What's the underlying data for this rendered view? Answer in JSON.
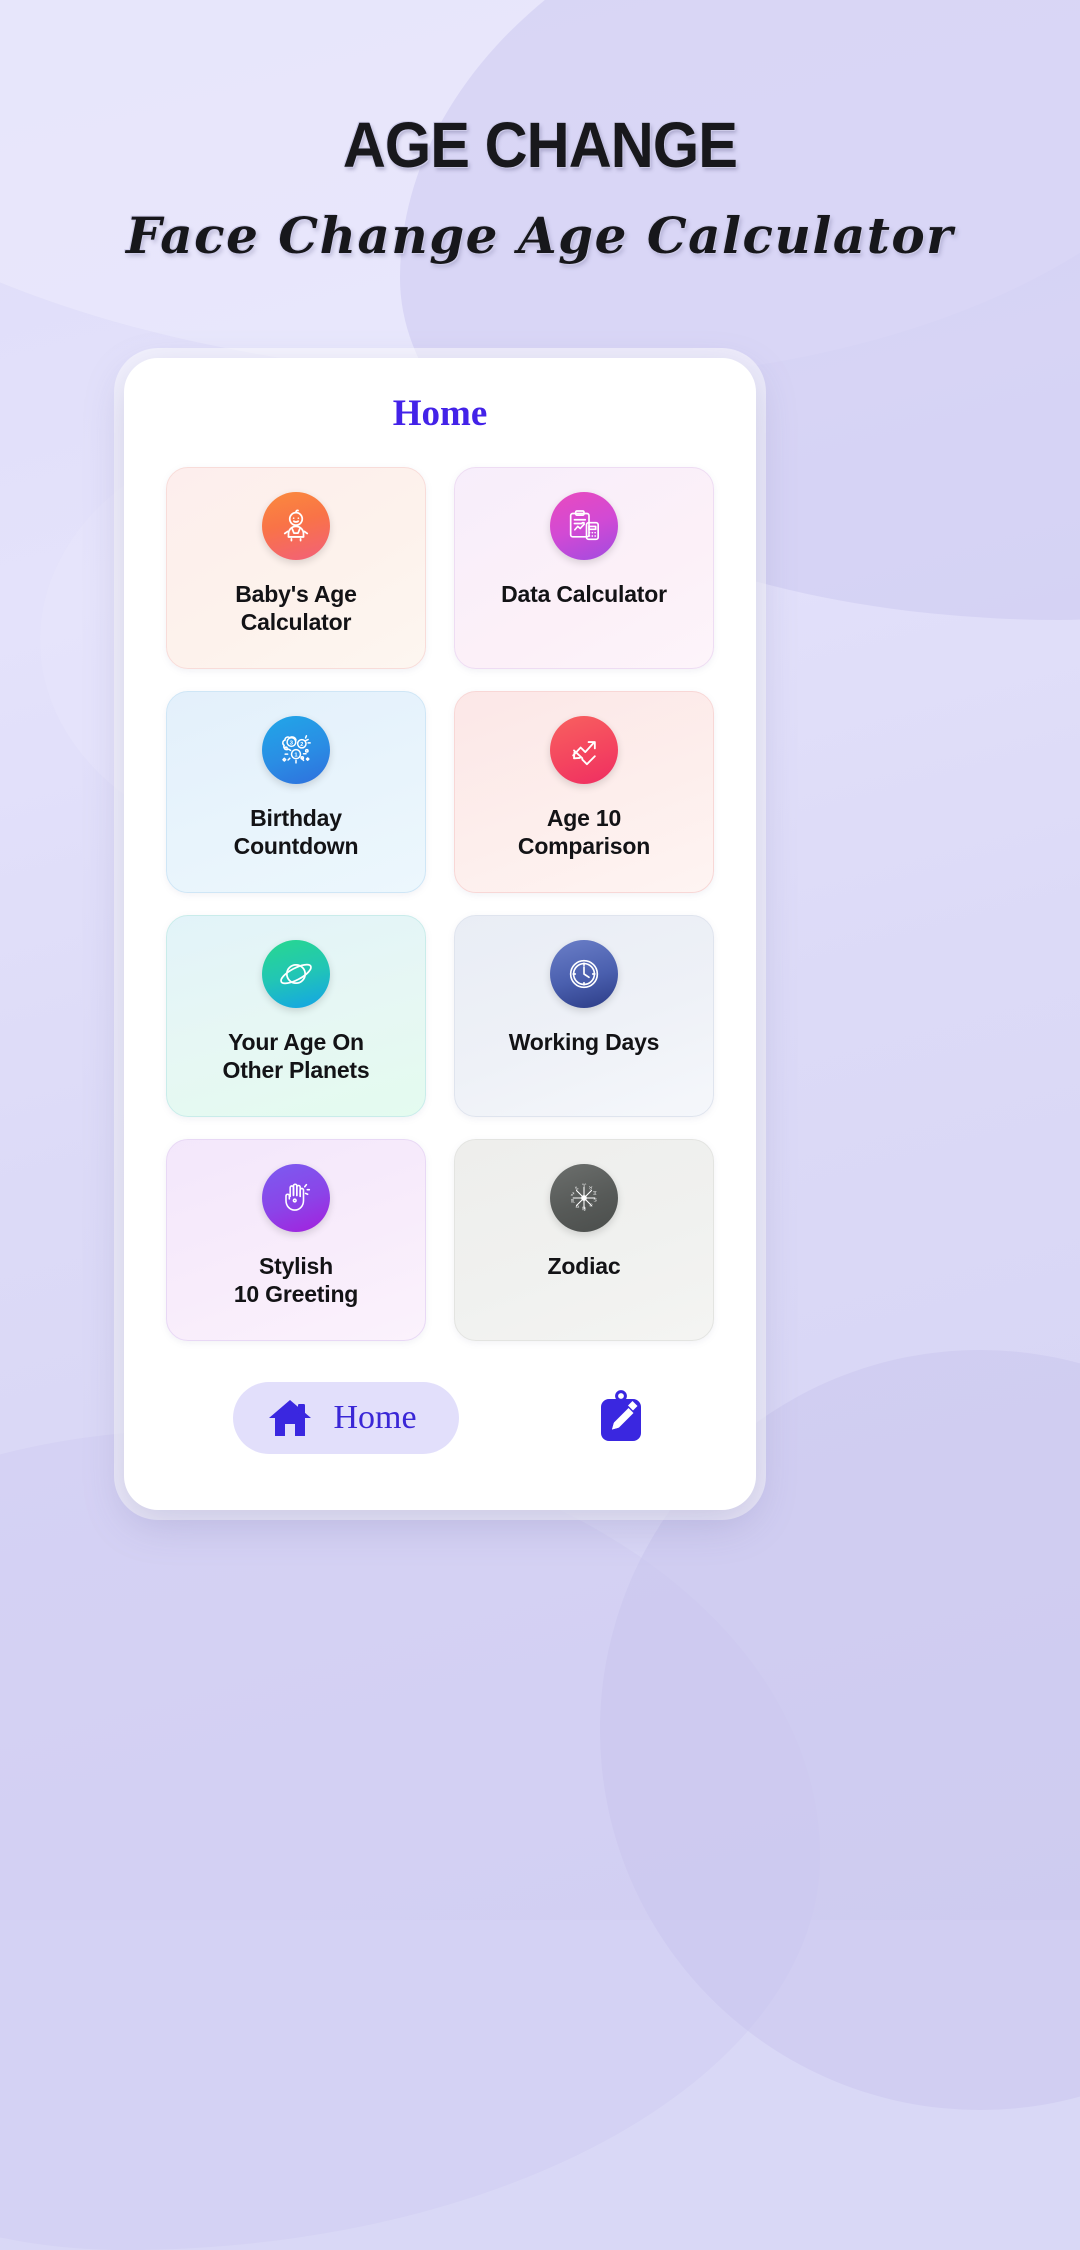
{
  "header": {
    "title": "AGE CHANGE",
    "subtitle": "Face Change Age Calculator"
  },
  "screen": {
    "title": "Home",
    "title_color": "#4322e8"
  },
  "tiles": [
    {
      "label": "Baby's Age\nCalculator",
      "line1": "Baby's Age",
      "line2": "Calculator",
      "icon": "baby-icon",
      "card_color": "#fdeeed",
      "icon_color": "#fa8a3d"
    },
    {
      "label": "Data Calculator",
      "line1": "Data Calculator",
      "line2": "",
      "icon": "clipboard-calculator-icon",
      "card_color": "#f7eefb",
      "icon_color": "#e94bbe"
    },
    {
      "label": "Birthday\nCountdown",
      "line1": "Birthday",
      "line2": "Countdown",
      "icon": "countdown-burst-icon",
      "card_color": "#e3f0fb",
      "icon_color": "#21a7e8"
    },
    {
      "label": "Age 10\nComparison",
      "line1": "Age 10",
      "line2": "Comparison",
      "icon": "trending-arrows-icon",
      "card_color": "#fce7e7",
      "icon_color": "#f4455f"
    },
    {
      "label": "Your Age On\nOther Planets",
      "line1": "Your Age On",
      "line2": "Other Planets",
      "icon": "saturn-planet-icon",
      "card_color": "#e2f3f9",
      "icon_color": "#22c6b4"
    },
    {
      "label": "Working Days",
      "line1": "Working Days",
      "line2": "",
      "icon": "clock-icon",
      "card_color": "#e9edf5",
      "icon_color": "#4a5fae"
    },
    {
      "label": "Stylish\n10 Greeting",
      "line1": "Stylish",
      "line2": "10 Greeting",
      "icon": "greeting-hands-icon",
      "card_color": "#f3e7fb",
      "icon_color": "#8b44e8"
    },
    {
      "label": "Zodiac",
      "line1": "Zodiac",
      "line2": "",
      "icon": "zodiac-wheel-icon",
      "card_color": "#eeeeec",
      "icon_color": "#575a58"
    }
  ],
  "bottom_nav": {
    "home_label": "Home",
    "home_icon": "house-icon",
    "home_pill_color": "#e2dffb",
    "home_accent": "#3a27d6",
    "notes_icon": "clipboard-pencil-icon",
    "notes_color": "#3a27e0"
  }
}
